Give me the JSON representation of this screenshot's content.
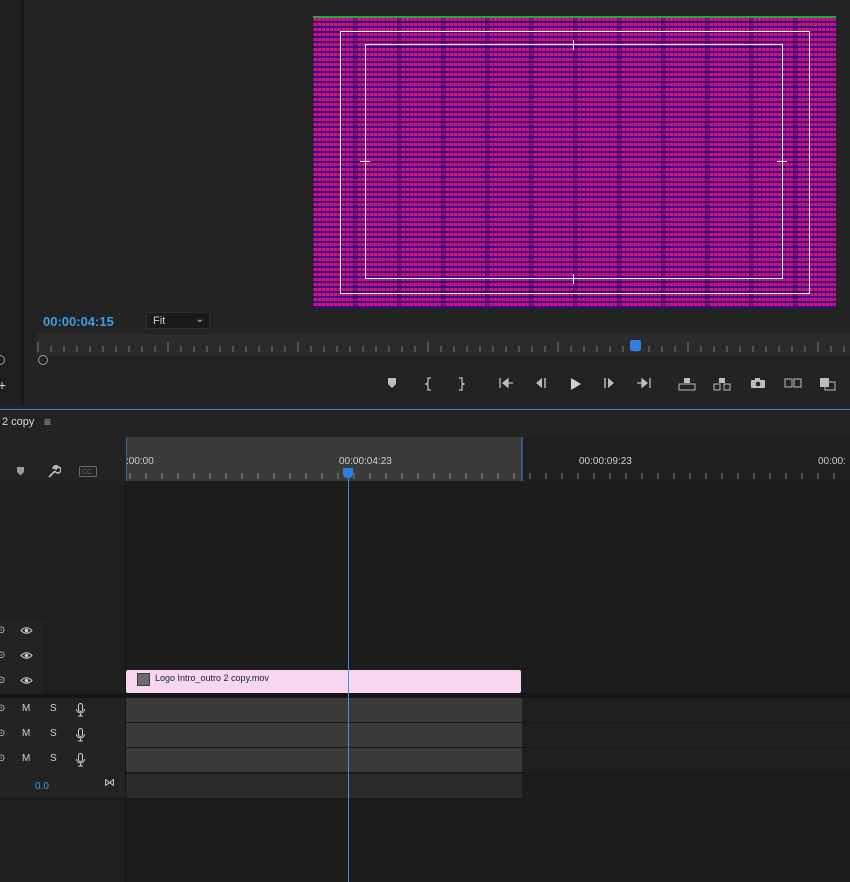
{
  "monitor": {
    "timecode": "00:00:04:15",
    "fit": {
      "value": "Fit",
      "chevron": "chevron-down-icon"
    },
    "playhead_position": 0.73,
    "controls": [
      {
        "name": "add-marker-button",
        "icon": "marker-icon"
      },
      {
        "name": "mark-in-button",
        "icon": "mark-in-icon"
      },
      {
        "name": "mark-out-button",
        "icon": "mark-out-icon"
      },
      {
        "name": "go-to-in-button",
        "icon": "go-to-in-icon"
      },
      {
        "name": "step-back-button",
        "icon": "step-back-icon"
      },
      {
        "name": "play-button",
        "icon": "play-icon"
      },
      {
        "name": "step-forward-button",
        "icon": "step-forward-icon"
      },
      {
        "name": "go-to-out-button",
        "icon": "go-to-out-icon"
      },
      {
        "name": "lift-button",
        "icon": "lift-icon"
      },
      {
        "name": "extract-button",
        "icon": "extract-icon"
      },
      {
        "name": "export-frame-button",
        "icon": "camera-icon"
      },
      {
        "name": "comparison-view-button",
        "icon": "comparison-icon"
      },
      {
        "name": "button-editor-button",
        "icon": "button-editor-icon"
      }
    ]
  },
  "timeline": {
    "sequence_tab": "2 copy",
    "menu_icon": "hamburger-icon",
    "ruler": {
      "labels": [
        ":00:00",
        "00:00:04:23",
        "00:00:09:23",
        "00:00:"
      ]
    },
    "tools": [
      "marker-icon",
      "wrench-icon",
      "captions-icon"
    ],
    "video_tracks": [
      {
        "eye": "eye-icon"
      },
      {
        "eye": "eye-icon"
      },
      {
        "eye": "eye-icon",
        "clip": "Logo Intro_outro 2 copy.mov"
      }
    ],
    "audio_tracks": [
      {
        "m": "M",
        "s": "S",
        "mic": "microphone-icon"
      },
      {
        "m": "M",
        "s": "S",
        "mic": "microphone-icon"
      },
      {
        "m": "M",
        "s": "S",
        "mic": "microphone-icon"
      }
    ],
    "master": {
      "value": "0.0",
      "icon": "bowtie-icon"
    }
  },
  "colors": {
    "accent": "#2f7fe0",
    "timecode": "#3b9fe6",
    "clip": "#f8d6f2",
    "video_noise": "#d0177c"
  }
}
